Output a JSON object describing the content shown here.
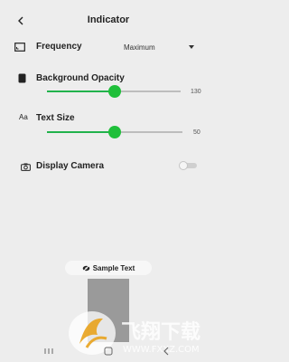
{
  "header": {
    "title": "Indicator",
    "back_icon": "arrow-left-icon"
  },
  "frequency": {
    "label": "Frequency",
    "icon": "frame-icon",
    "selected": "Maximum"
  },
  "background_opacity": {
    "label": "Background Opacity",
    "icon": "opacity-icon",
    "value": "130",
    "fraction": 0.51
  },
  "text_size": {
    "label": "Text Size",
    "icon_text": "Aa",
    "value": "50",
    "fraction": 0.5
  },
  "display_camera": {
    "label": "Display Camera",
    "icon": "camera-icon",
    "enabled": false
  },
  "sample": {
    "label": "Sample Text"
  },
  "watermark": {
    "text": "飞翔下载",
    "url": "WWW.FXXZ.COM"
  },
  "colors": {
    "accent": "#1fbf3a",
    "background": "#ededed"
  }
}
